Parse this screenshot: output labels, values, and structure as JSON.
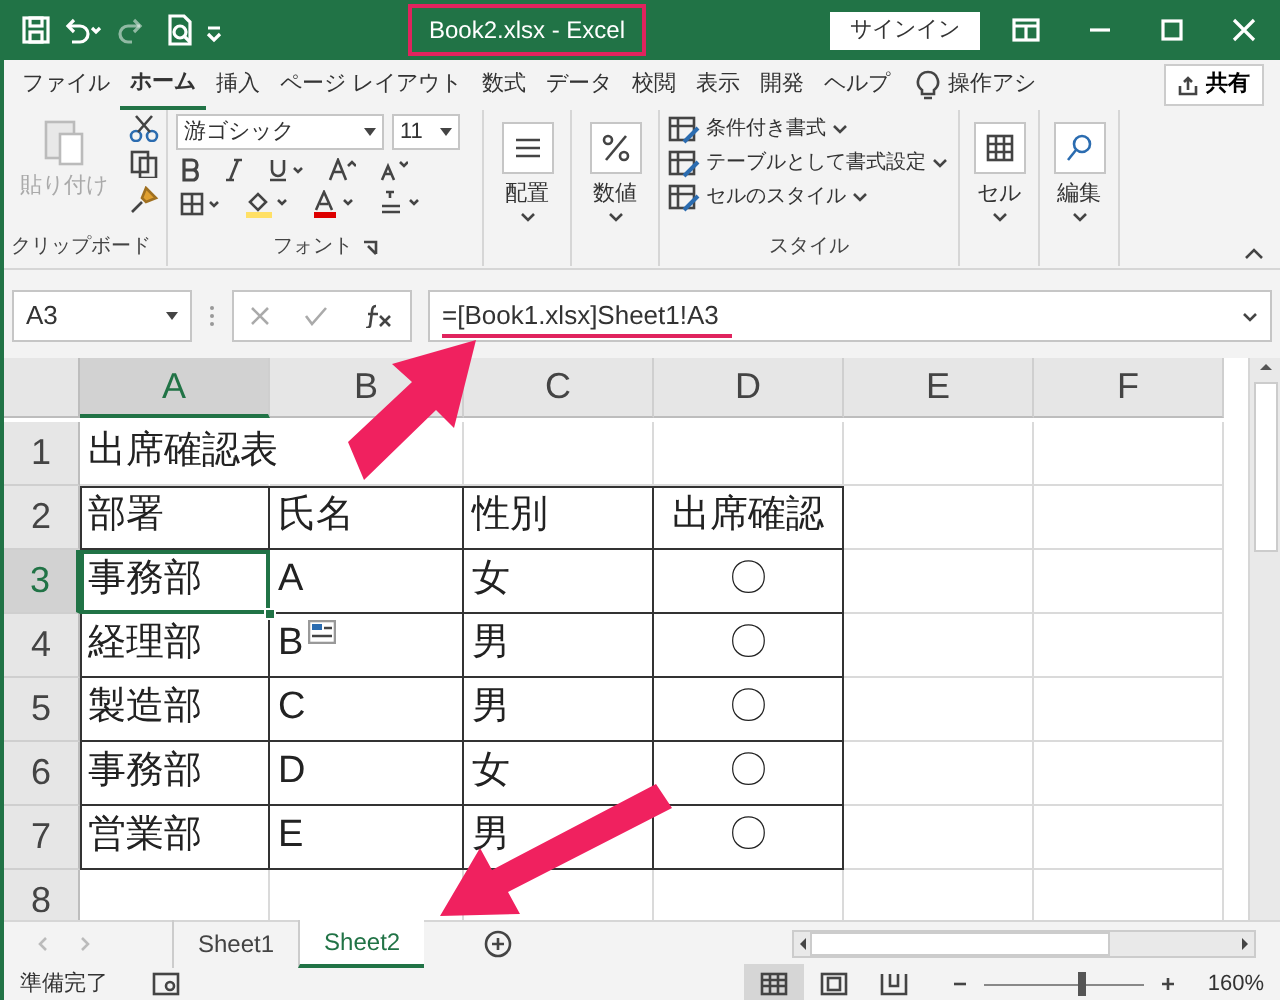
{
  "title_bar": {
    "title": "Book2.xlsx  -  Excel",
    "sign_in": "サインイン"
  },
  "ribbon_tabs": [
    {
      "label": "ファイル",
      "selected": false
    },
    {
      "label": "ホーム",
      "selected": true
    },
    {
      "label": "挿入",
      "selected": false
    },
    {
      "label": "ページ レイアウト",
      "selected": false
    },
    {
      "label": "数式",
      "selected": false
    },
    {
      "label": "データ",
      "selected": false
    },
    {
      "label": "校閲",
      "selected": false
    },
    {
      "label": "表示",
      "selected": false
    },
    {
      "label": "開発",
      "selected": false
    },
    {
      "label": "ヘルプ",
      "selected": false
    }
  ],
  "tell_me": "操作アシ",
  "share": "共有",
  "ribbon": {
    "clipboard": {
      "paste": "貼り付け",
      "paste_disabled": true,
      "label": "クリップボード"
    },
    "font": {
      "font_name": "游ゴシック",
      "font_size": "11",
      "label": "フォント"
    },
    "alignment": "配置",
    "number": "数値",
    "styles": {
      "items": [
        "条件付き書式",
        "テーブルとして書式設定",
        "セルのスタイル"
      ],
      "label": "スタイル"
    },
    "cells": "セル",
    "editing": "編集"
  },
  "formula_bar": {
    "name_box": "A3",
    "formula": "=[Book1.xlsx]Sheet1!A3"
  },
  "columns": [
    {
      "label": "A",
      "selected": true
    },
    {
      "label": "B",
      "selected": false
    },
    {
      "label": "C",
      "selected": false
    },
    {
      "label": "D",
      "selected": false
    },
    {
      "label": "E",
      "selected": false
    },
    {
      "label": "F",
      "selected": false
    }
  ],
  "rows": [
    {
      "header": "1",
      "selected": false,
      "bordered": false,
      "cells": [
        "出席確認表"
      ]
    },
    {
      "header": "2",
      "selected": false,
      "bordered": true,
      "cells": [
        "部署",
        "氏名",
        "性別",
        "出席確認"
      ]
    },
    {
      "header": "3",
      "selected": true,
      "bordered": true,
      "cells": [
        "事務部",
        "A",
        "女",
        "〇"
      ]
    },
    {
      "header": "4",
      "selected": false,
      "bordered": true,
      "cells": [
        "経理部",
        "B",
        "男",
        "〇"
      ]
    },
    {
      "header": "5",
      "selected": false,
      "bordered": true,
      "cells": [
        "製造部",
        "C",
        "男",
        "〇"
      ]
    },
    {
      "header": "6",
      "selected": false,
      "bordered": true,
      "cells": [
        "事務部",
        "D",
        "女",
        "〇"
      ]
    },
    {
      "header": "7",
      "selected": false,
      "bordered": true,
      "cells": [
        "営業部",
        "E",
        "男",
        "〇"
      ]
    },
    {
      "header": "8",
      "selected": false
    }
  ],
  "sheet_tabs": [
    {
      "label": "Sheet1",
      "selected": false
    },
    {
      "label": "Sheet2",
      "selected": true
    }
  ],
  "status_bar": {
    "status": "準備完了",
    "views": [
      {
        "selected": true
      },
      {
        "selected": false
      },
      {
        "selected": false
      }
    ],
    "zoom_slider": {
      "level": 0.62
    },
    "zoom": "160%"
  }
}
